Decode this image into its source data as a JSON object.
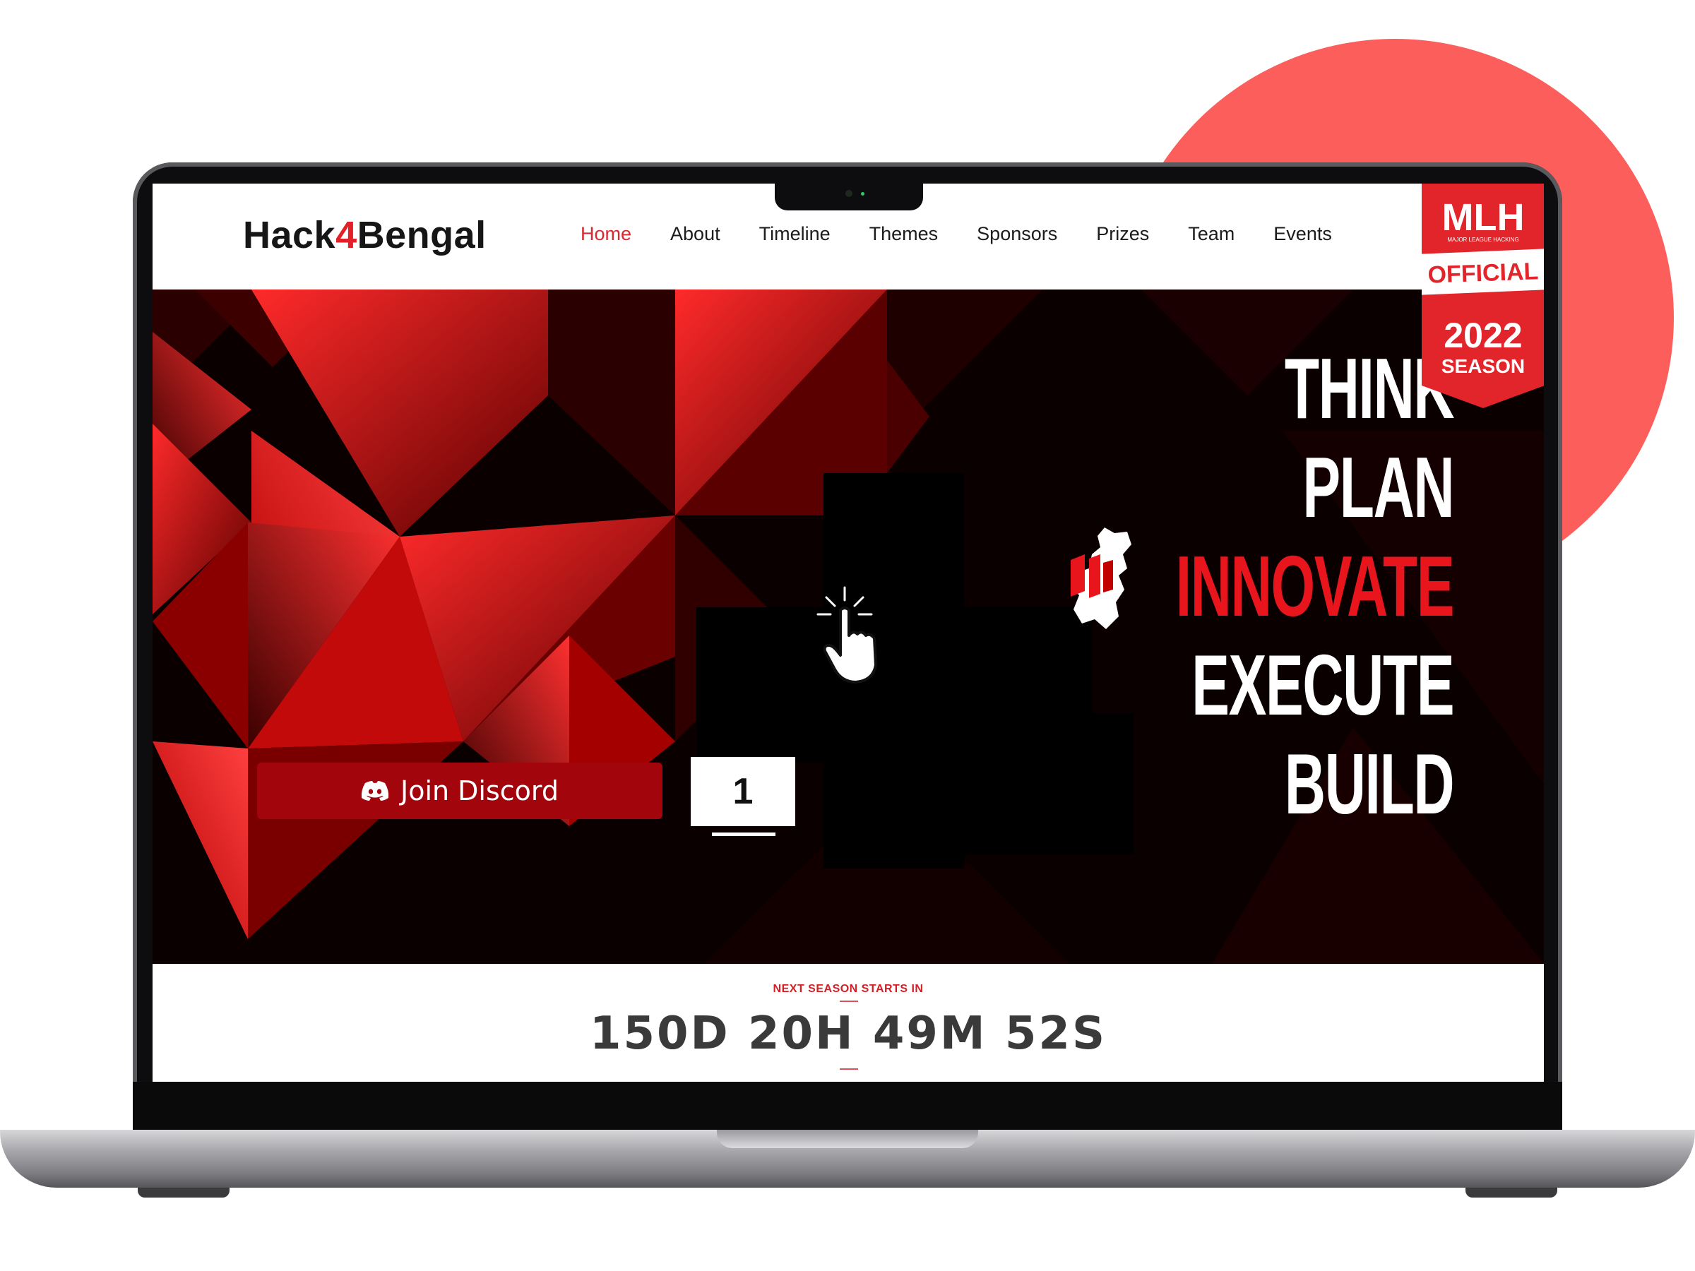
{
  "brand": {
    "prefix": "Hack",
    "digit": "4",
    "suffix": "Bengal"
  },
  "nav": {
    "items": [
      "Home",
      "About",
      "Timeline",
      "Themes",
      "Sponsors",
      "Prizes",
      "Team",
      "Events"
    ],
    "active": "Home"
  },
  "mlh_badge": {
    "title": "MLH",
    "subtitle": "MAJOR LEAGUE HACKING",
    "ribbon": "OFFICIAL",
    "year": "2022",
    "season": "SEASON"
  },
  "hero": {
    "words": [
      "THINK",
      "PLAN",
      "INNOVATE",
      "EXECUTE",
      "BUILD"
    ],
    "highlight_word": "INNOVATE",
    "discord_button": "Join Discord",
    "slide_number": "1"
  },
  "countdown": {
    "label": "NEXT SEASON STARTS IN",
    "value": "150D 20H 49M 52S"
  },
  "colors": {
    "accent": "#e32027",
    "background_circle": "#fc5e5c",
    "button": "#a3050c"
  }
}
